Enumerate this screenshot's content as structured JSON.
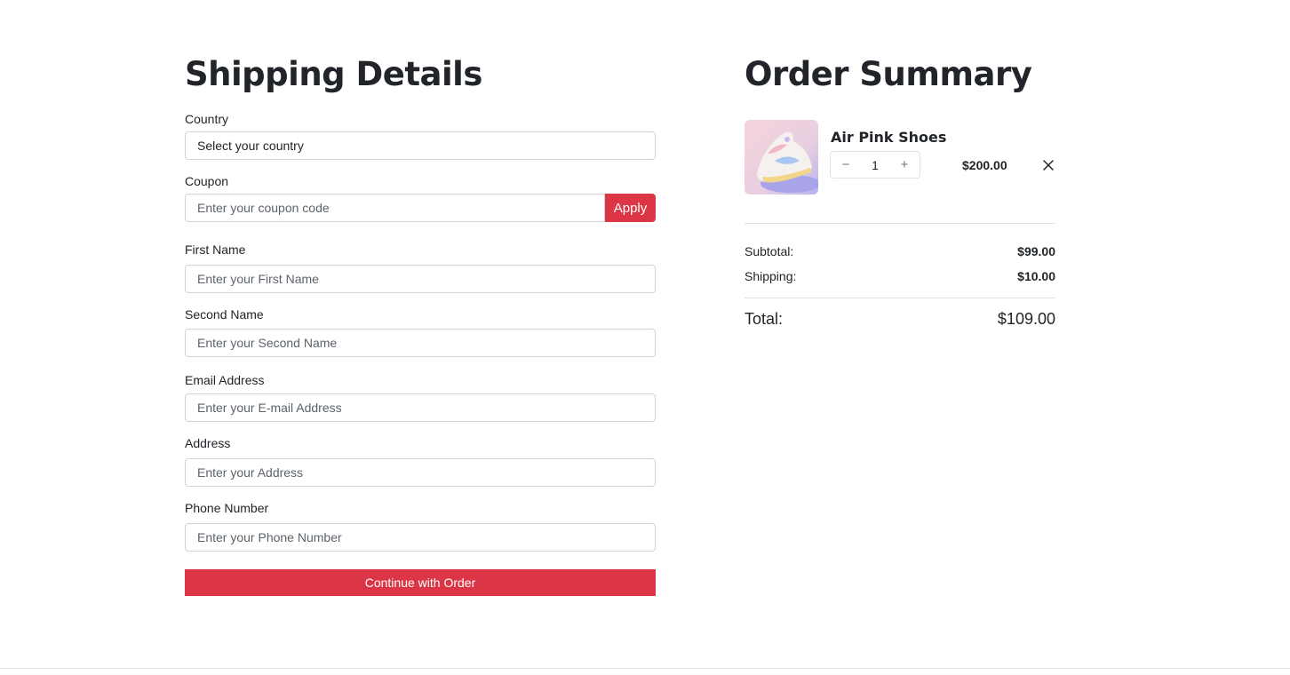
{
  "shipping": {
    "title": "Shipping Details",
    "country": {
      "label": "Country",
      "value": "Select your country"
    },
    "coupon": {
      "label": "Coupon",
      "placeholder": "Enter your coupon code",
      "apply_label": "Apply"
    },
    "first_name": {
      "label": "First Name",
      "placeholder": "Enter your First Name"
    },
    "second_name": {
      "label": "Second Name",
      "placeholder": "Enter your Second Name"
    },
    "email": {
      "label": "Email Address",
      "placeholder": "Enter your E-mail Address"
    },
    "address": {
      "label": "Address",
      "placeholder": "Enter your Address"
    },
    "phone": {
      "label": "Phone Number",
      "placeholder": "Enter your Phone Number"
    },
    "submit_label": "Continue with Order"
  },
  "summary": {
    "title": "Order Summary",
    "item": {
      "name": "Air Pink Shoes",
      "quantity": "1",
      "price": "$200.00",
      "decrement_symbol": "−",
      "increment_symbol": "+"
    },
    "subtotal_label": "Subtotal:",
    "subtotal_value": "$99.00",
    "shipping_label": "Shipping:",
    "shipping_value": "$10.00",
    "total_label": "Total:",
    "total_value": "$109.00"
  },
  "colors": {
    "accent": "#dc3545",
    "text": "#212529",
    "border": "#ced4da"
  },
  "icons": {
    "remove": "close-icon",
    "product": "sneaker-image"
  }
}
